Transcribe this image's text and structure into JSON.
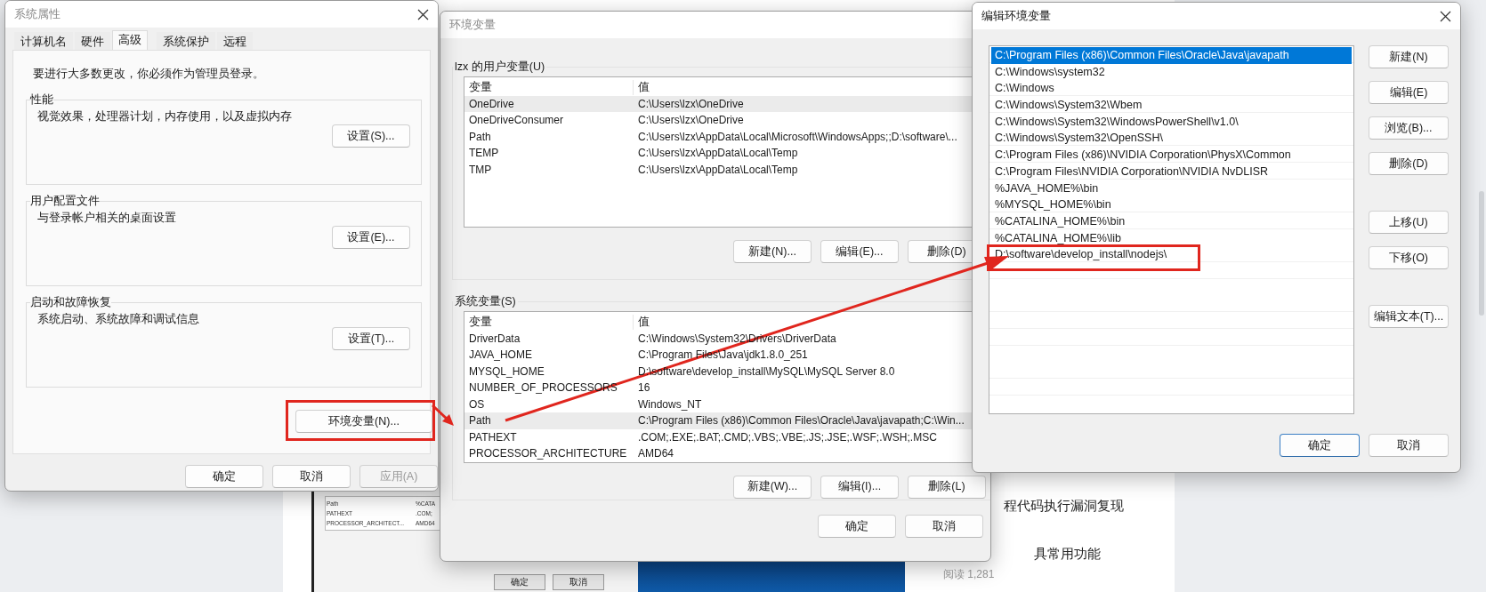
{
  "background": {
    "thumbnail": {
      "rows": [
        {
          "name": "Path",
          "value": "%CATA"
        },
        {
          "name": "PATHEXT",
          "value": ".COM;"
        },
        {
          "name": "PROCESSOR_ARCHITECT...",
          "value": "AMD64"
        }
      ],
      "buttons": [
        "确定",
        "取消"
      ]
    },
    "article_lines": [
      "程代码执行漏洞复现",
      "具常用功能"
    ],
    "read_count": "阅读 1,281"
  },
  "system_properties": {
    "title": "系统属性",
    "tabs": [
      {
        "label": "计算机名",
        "selected": false
      },
      {
        "label": "硬件",
        "selected": false
      },
      {
        "label": "高级",
        "selected": true
      },
      {
        "label": "系统保护",
        "selected": false
      },
      {
        "label": "远程",
        "selected": false
      }
    ],
    "notice": "要进行大多数更改，你必须作为管理员登录。",
    "groups": [
      {
        "title": "性能",
        "description": "视觉效果，处理器计划，内存使用，以及虚拟内存",
        "button": "设置(S)..."
      },
      {
        "title": "用户配置文件",
        "description": "与登录帐户相关的桌面设置",
        "button": "设置(E)..."
      },
      {
        "title": "启动和故障恢复",
        "description": "系统启动、系统故障和调试信息",
        "button": "设置(T)..."
      }
    ],
    "env_button": {
      "label": "环境变量(N)...",
      "highlighted": true
    },
    "footer_buttons": [
      {
        "label": "确定",
        "disabled": false
      },
      {
        "label": "取消",
        "disabled": false
      },
      {
        "label": "应用(A)",
        "disabled": true
      }
    ]
  },
  "environment_variables": {
    "title": "环境变量",
    "sections": [
      {
        "title": "lzx 的用户变量(U)",
        "columns": [
          "变量",
          "值"
        ],
        "rows": [
          {
            "name": "OneDrive",
            "value": "C:\\Users\\lzx\\OneDrive",
            "selected": true
          },
          {
            "name": "OneDriveConsumer",
            "value": "C:\\Users\\lzx\\OneDrive",
            "selected": false
          },
          {
            "name": "Path",
            "value": "C:\\Users\\lzx\\AppData\\Local\\Microsoft\\WindowsApps;;D:\\software\\...",
            "selected": false
          },
          {
            "name": "TEMP",
            "value": "C:\\Users\\lzx\\AppData\\Local\\Temp",
            "selected": false
          },
          {
            "name": "TMP",
            "value": "C:\\Users\\lzx\\AppData\\Local\\Temp",
            "selected": false
          }
        ],
        "buttons": [
          "新建(N)...",
          "编辑(E)...",
          "删除(D)"
        ]
      },
      {
        "title": "系统变量(S)",
        "columns": [
          "变量",
          "值"
        ],
        "rows": [
          {
            "name": "DriverData",
            "value": "C:\\Windows\\System32\\Drivers\\DriverData",
            "selected": false
          },
          {
            "name": "JAVA_HOME",
            "value": "C:\\Program Files\\Java\\jdk1.8.0_251",
            "selected": false
          },
          {
            "name": "MYSQL_HOME",
            "value": "D:\\software\\develop_install\\MySQL\\MySQL Server 8.0",
            "selected": false
          },
          {
            "name": "NUMBER_OF_PROCESSORS",
            "value": "16",
            "selected": false
          },
          {
            "name": "OS",
            "value": "Windows_NT",
            "selected": false
          },
          {
            "name": "Path",
            "value": "C:\\Program Files (x86)\\Common Files\\Oracle\\Java\\javapath;C:\\Win...",
            "selected": true
          },
          {
            "name": "PATHEXT",
            "value": ".COM;.EXE;.BAT;.CMD;.VBS;.VBE;.JS;.JSE;.WSF;.WSH;.MSC",
            "selected": false
          },
          {
            "name": "PROCESSOR_ARCHITECTURE",
            "value": "AMD64",
            "selected": false
          }
        ],
        "buttons": [
          "新建(W)...",
          "编辑(I)...",
          "删除(L)"
        ]
      }
    ],
    "footer_buttons": [
      "确定",
      "取消"
    ]
  },
  "edit_environment_variable": {
    "title": "编辑环境变量",
    "entries": [
      {
        "text": "C:\\Program Files (x86)\\Common Files\\Oracle\\Java\\javapath",
        "selected": true,
        "highlighted": false
      },
      {
        "text": "C:\\Windows\\system32",
        "selected": false,
        "highlighted": false
      },
      {
        "text": "C:\\Windows",
        "selected": false,
        "highlighted": false
      },
      {
        "text": "C:\\Windows\\System32\\Wbem",
        "selected": false,
        "highlighted": false
      },
      {
        "text": "C:\\Windows\\System32\\WindowsPowerShell\\v1.0\\",
        "selected": false,
        "highlighted": false
      },
      {
        "text": "C:\\Windows\\System32\\OpenSSH\\",
        "selected": false,
        "highlighted": false
      },
      {
        "text": "C:\\Program Files (x86)\\NVIDIA Corporation\\PhysX\\Common",
        "selected": false,
        "highlighted": false
      },
      {
        "text": "C:\\Program Files\\NVIDIA Corporation\\NVIDIA NvDLISR",
        "selected": false,
        "highlighted": false
      },
      {
        "text": "%JAVA_HOME%\\bin",
        "selected": false,
        "highlighted": false
      },
      {
        "text": "%MYSQL_HOME%\\bin",
        "selected": false,
        "highlighted": false
      },
      {
        "text": "%CATALINA_HOME%\\bin",
        "selected": false,
        "highlighted": false
      },
      {
        "text": "%CATALINA_HOME%\\lib",
        "selected": false,
        "highlighted": false
      },
      {
        "text": "D:\\software\\develop_install\\nodejs\\",
        "selected": false,
        "highlighted": true
      }
    ],
    "button_groups": [
      [
        "新建(N)",
        "编辑(E)",
        "浏览(B)...",
        "删除(D)"
      ],
      [
        "上移(U)",
        "下移(O)"
      ],
      [
        "编辑文本(T)..."
      ]
    ],
    "footer_buttons": [
      {
        "label": "确定",
        "default": true
      },
      {
        "label": "取消",
        "default": false
      }
    ]
  }
}
